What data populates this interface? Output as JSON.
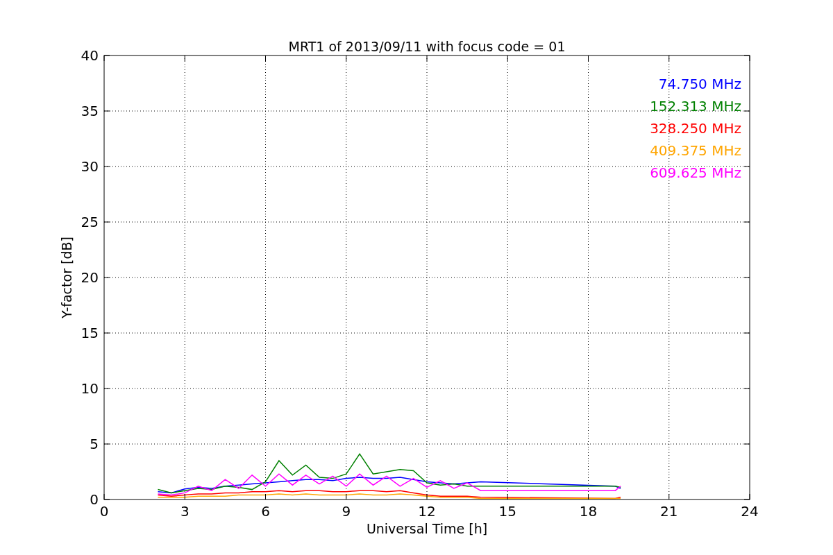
{
  "figure": {
    "chart_data": {
      "type": "line",
      "title": "MRT1 of 2013/09/11 with focus code = 01",
      "xlabel": "Universal Time [h]",
      "ylabel": "Y-factor [dB]",
      "x": [
        2,
        2.5,
        3,
        3.5,
        4,
        4.5,
        5,
        5.5,
        6,
        6.5,
        7,
        7.5,
        8,
        8.5,
        9,
        9.5,
        10,
        10.5,
        11,
        11.5,
        12,
        12.5,
        13,
        13.5,
        14,
        19,
        19.2
      ],
      "series": [
        {
          "name": "74.750 MHz",
          "color": "#0000ff",
          "values": [
            0.7,
            0.6,
            0.95,
            1.1,
            1.0,
            1.2,
            1.3,
            1.4,
            1.5,
            1.6,
            1.7,
            1.8,
            1.8,
            1.7,
            1.9,
            2.0,
            1.9,
            1.9,
            2.0,
            1.8,
            1.6,
            1.5,
            1.4,
            1.5,
            1.6,
            1.2,
            1.0
          ]
        },
        {
          "name": "152.313 MHz",
          "color": "#008000",
          "values": [
            0.9,
            0.6,
            0.8,
            1.0,
            0.9,
            1.2,
            1.1,
            0.9,
            1.6,
            3.5,
            2.2,
            3.1,
            2.0,
            1.9,
            2.3,
            4.1,
            2.3,
            2.5,
            2.7,
            2.6,
            1.5,
            1.3,
            1.4,
            1.2,
            1.2,
            1.2,
            1.1
          ]
        },
        {
          "name": "328.250 MHz",
          "color": "#ff0000",
          "values": [
            0.4,
            0.3,
            0.4,
            0.5,
            0.5,
            0.6,
            0.6,
            0.7,
            0.7,
            0.8,
            0.7,
            0.8,
            0.8,
            0.7,
            0.7,
            0.8,
            0.8,
            0.7,
            0.8,
            0.6,
            0.4,
            0.3,
            0.3,
            0.3,
            0.2,
            0.1,
            0.2
          ]
        },
        {
          "name": "409.375 MHz",
          "color": "#ffa500",
          "values": [
            0.2,
            0.2,
            0.2,
            0.3,
            0.3,
            0.3,
            0.4,
            0.4,
            0.4,
            0.5,
            0.4,
            0.5,
            0.4,
            0.4,
            0.4,
            0.5,
            0.4,
            0.4,
            0.5,
            0.4,
            0.3,
            0.2,
            0.2,
            0.2,
            0.1,
            0.1,
            0.1
          ]
        },
        {
          "name": "609.625 MHz",
          "color": "#ff00ff",
          "values": [
            0.5,
            0.4,
            0.6,
            1.2,
            0.8,
            1.8,
            1.0,
            2.2,
            1.2,
            2.3,
            1.3,
            2.2,
            1.4,
            2.1,
            1.2,
            2.3,
            1.3,
            2.1,
            1.2,
            1.9,
            1.1,
            1.7,
            1.0,
            1.5,
            0.8,
            0.8,
            1.2
          ]
        }
      ],
      "xlim": [
        0,
        24
      ],
      "ylim": [
        0,
        40
      ],
      "xticks": [
        0,
        3,
        6,
        9,
        12,
        15,
        18,
        21,
        24
      ],
      "yticks": [
        0,
        5,
        10,
        15,
        20,
        25,
        30,
        35,
        40
      ],
      "grid": true
    }
  }
}
